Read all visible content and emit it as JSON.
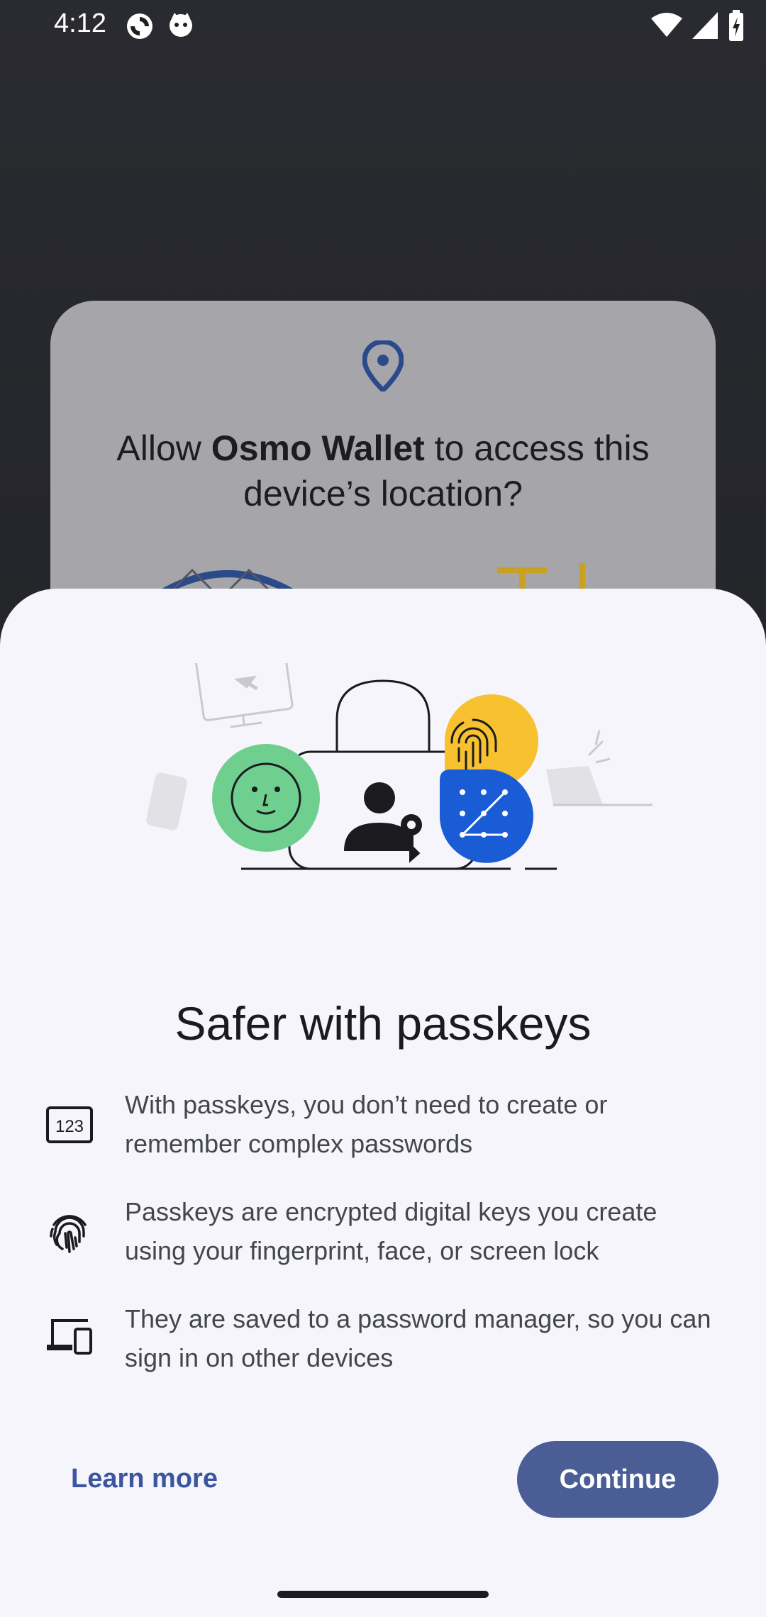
{
  "status_bar": {
    "time": "4:12",
    "left_icons": [
      "sync-icon",
      "cat-icon"
    ],
    "right_icons": [
      "wifi-icon",
      "cellular-signal-icon",
      "battery-charging-icon"
    ]
  },
  "permission_dialog": {
    "icon": "location-pin-icon",
    "title_prefix": "Allow ",
    "app_name": "Osmo Wallet",
    "title_suffix": " to access this device’s location?"
  },
  "sheet": {
    "hero_icons": [
      "monitor-icon",
      "phone-icon",
      "laptop-icon",
      "face-icon",
      "fingerprint-icon",
      "pattern-lock-icon",
      "user-key-icon",
      "padlock-icon"
    ],
    "title": "Safer with passkeys",
    "features": [
      {
        "icon": "pin-123-icon",
        "text": "With passkeys, you don’t need to create or remember complex passwords"
      },
      {
        "icon": "fingerprint-icon",
        "text": "Passkeys are encrypted digital keys you create using your fingerprint, face, or screen lock"
      },
      {
        "icon": "devices-icon",
        "text": "They are saved to a password manager, so you can sign in on other devices"
      }
    ],
    "learn_more_label": "Learn more",
    "continue_label": "Continue"
  },
  "colors": {
    "sheet_background": "#f5f5fb",
    "primary_button": "#4b5d95",
    "link_text": "#3b55a0",
    "face_circle": "#6fcf8f",
    "fingerprint_circle": "#f7c12f",
    "pattern_circle": "#1a5bd6"
  }
}
